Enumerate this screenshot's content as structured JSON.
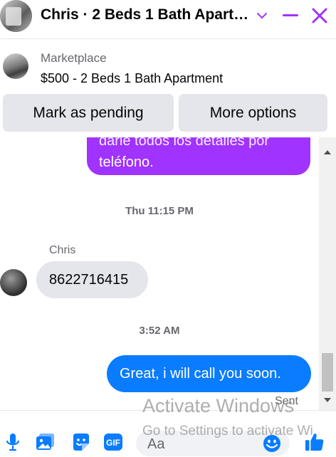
{
  "header": {
    "title": "Chris · 2 Beds 1 Bath Apart…",
    "accent_color": "#a033ff"
  },
  "listing": {
    "kicker": "Marketplace",
    "title": "$500 - 2 Beds 1 Bath Apartment",
    "buttons": {
      "pending": "Mark as pending",
      "more": "More options"
    }
  },
  "conversation": {
    "outgoing_partial": {
      "line1": "darle todos los detalles por",
      "line2": "teléfono."
    },
    "timestamp1": "Thu 11:15 PM",
    "sender_name": "Chris",
    "incoming_message": "8622716415",
    "timestamp2": "3:52 AM",
    "outgoing_message": "Great, i will call you soon.",
    "status": "Sent"
  },
  "composer": {
    "placeholder": "Aa",
    "icons": [
      "microphone-icon",
      "photo-icon",
      "sticker-icon",
      "gif-icon",
      "emoji-icon",
      "thumbs-up-icon"
    ],
    "gif_label": "GIF"
  },
  "watermark": {
    "line1": "Activate Windows",
    "line2": "Go to Settings to activate Wi"
  }
}
